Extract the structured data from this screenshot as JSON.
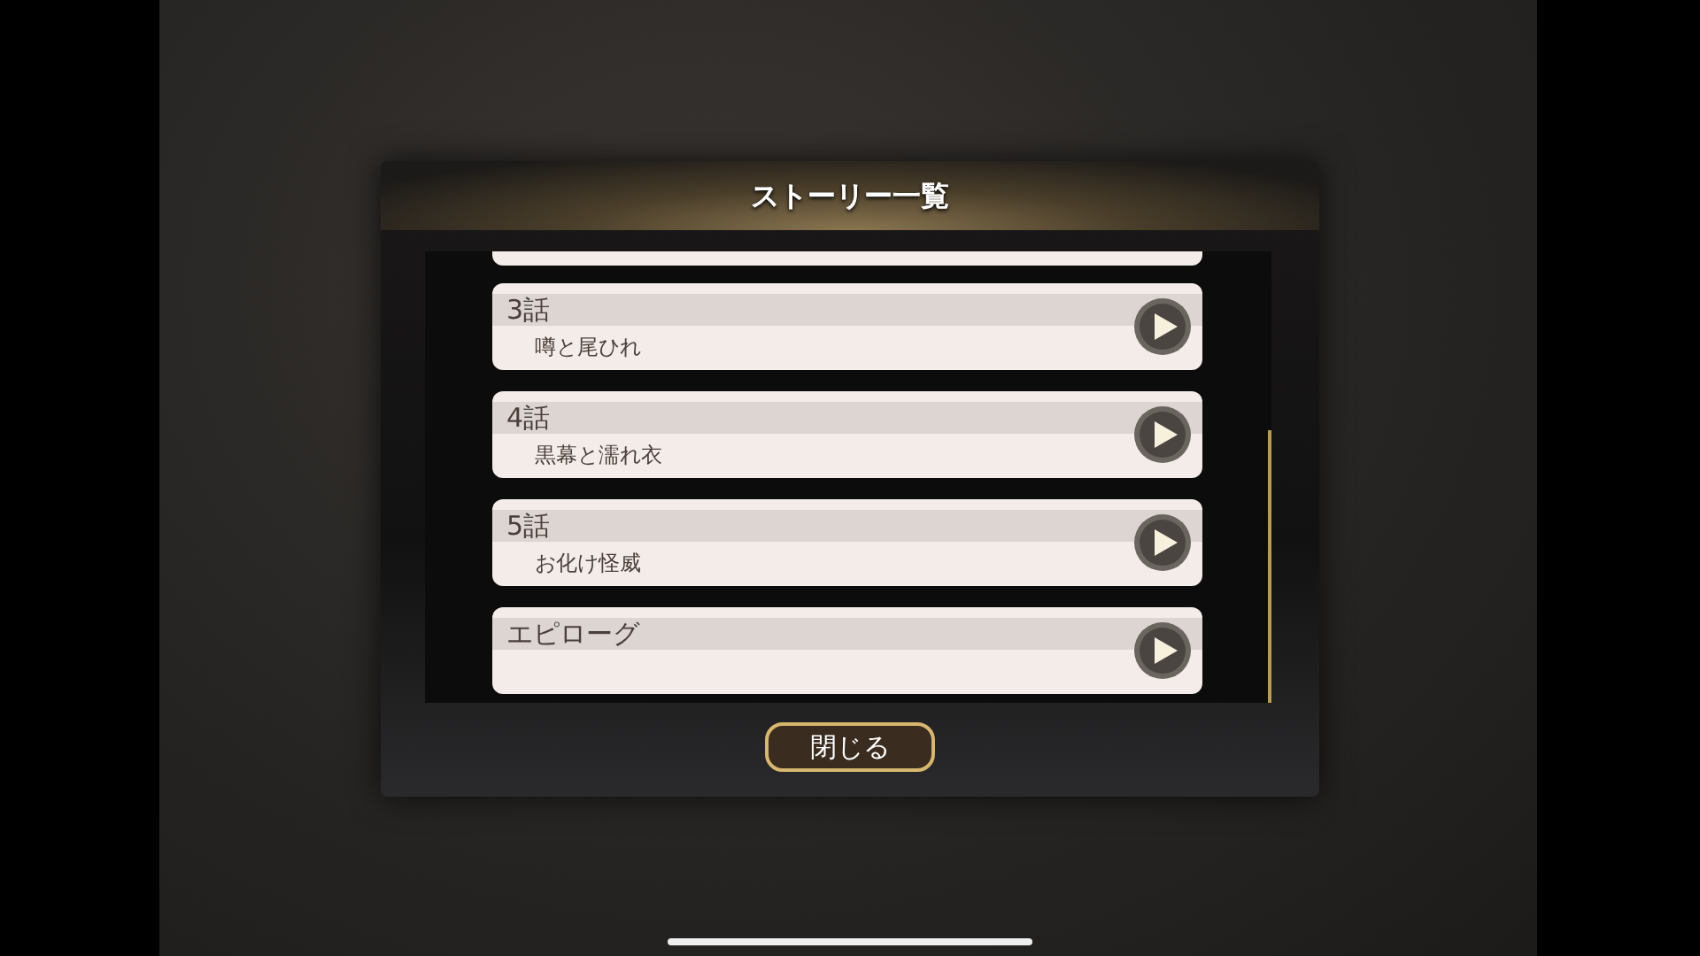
{
  "dialog": {
    "title": "ストーリー一覧"
  },
  "stories": [
    {
      "kind": "partial"
    },
    {
      "kind": "episode",
      "title": "3話",
      "subtitle": "噂と尾ひれ"
    },
    {
      "kind": "episode",
      "title": "4話",
      "subtitle": "黒幕と濡れ衣"
    },
    {
      "kind": "episode",
      "title": "5話",
      "subtitle": "お化け怪威"
    },
    {
      "kind": "episode",
      "title": "エピローグ"
    }
  ],
  "close_button": "閉じる"
}
